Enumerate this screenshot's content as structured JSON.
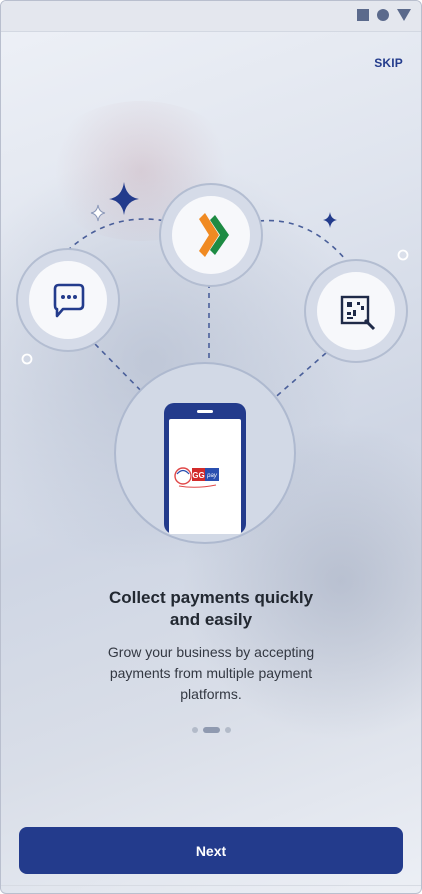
{
  "status_bar": {
    "icons": [
      "square-icon",
      "circle-icon",
      "triangle-icon"
    ]
  },
  "header": {
    "skip_label": "SKIP"
  },
  "illustration": {
    "icons": [
      "bhim-upi-logo",
      "chat-icon",
      "qr-scan-icon",
      "phone-icon"
    ],
    "phone_brand_text": "pay",
    "phone_brand_number": "GG"
  },
  "onboarding": {
    "title_line1": "Collect payments quickly",
    "title_line2": "and easily",
    "description_line1": "Grow your business by accepting",
    "description_line2": "payments from multiple payment",
    "description_line3": "platforms."
  },
  "pager": {
    "page_count": 3,
    "current_page": 2
  },
  "footer": {
    "next_label": "Next"
  },
  "colors": {
    "primary": "#233b8c",
    "text_dark": "#222831",
    "text_body": "#333842"
  }
}
